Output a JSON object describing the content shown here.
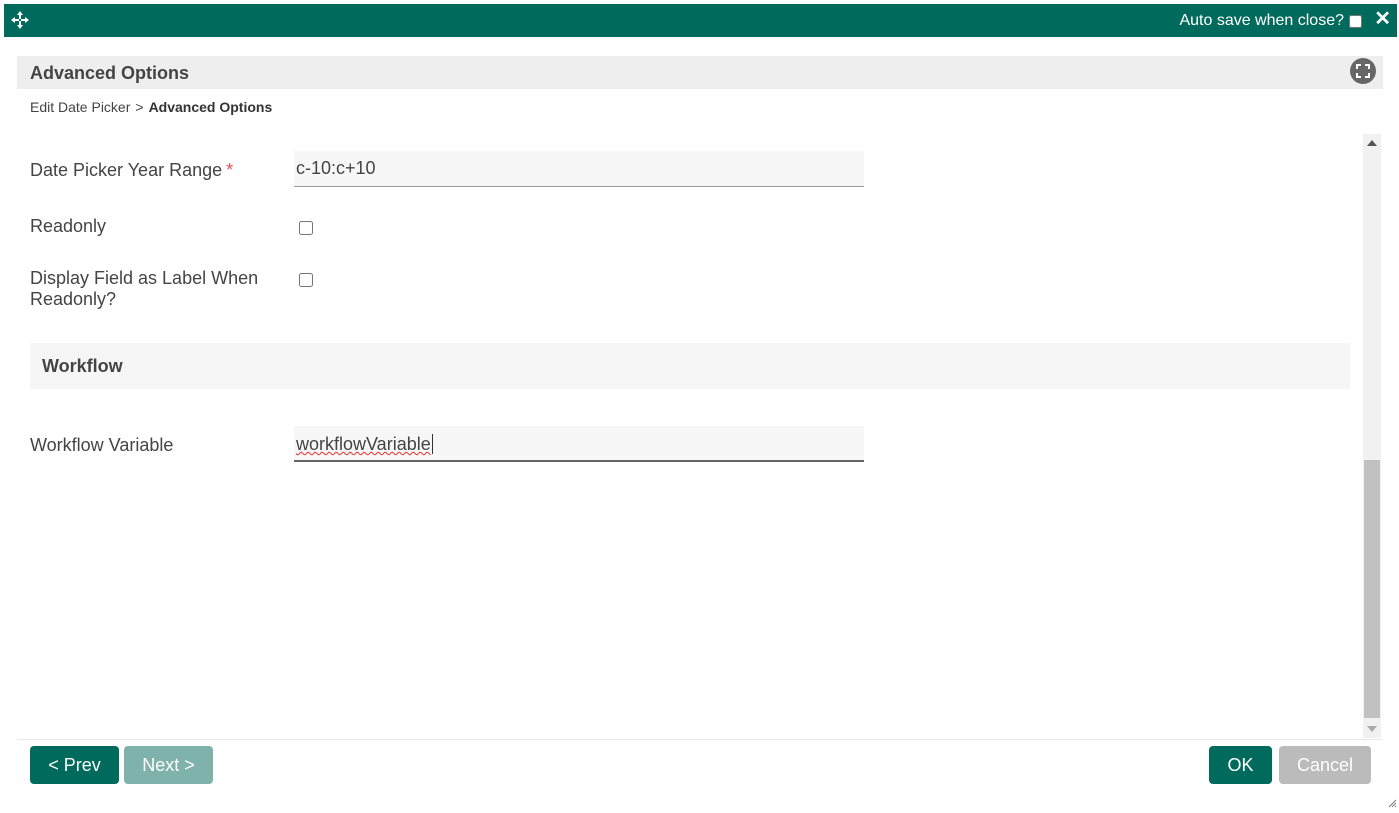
{
  "topbar": {
    "autosave_label": "Auto save when close?",
    "autosave_checked": false,
    "close_icon": "close-icon",
    "move_icon": "move-icon",
    "background": "#006b5c"
  },
  "header": {
    "title": "Advanced Options",
    "fullscreen_icon": "fullscreen-icon"
  },
  "breadcrumb": {
    "parent": "Edit Date Picker",
    "separator": ">",
    "current": "Advanced Options"
  },
  "form": {
    "year_range": {
      "label": "Date Picker Year Range",
      "required_mark": "*",
      "value": "c-10:c+10"
    },
    "readonly": {
      "label": "Readonly",
      "checked": false
    },
    "display_as_label": {
      "label": "Display Field as Label When Readonly?",
      "checked": false
    },
    "workflow_section": {
      "title": "Workflow"
    },
    "workflow_variable": {
      "label": "Workflow Variable",
      "value": "workflowVariable"
    }
  },
  "footer": {
    "prev_label": "< Prev",
    "next_label": "Next >",
    "ok_label": "OK",
    "cancel_label": "Cancel"
  }
}
